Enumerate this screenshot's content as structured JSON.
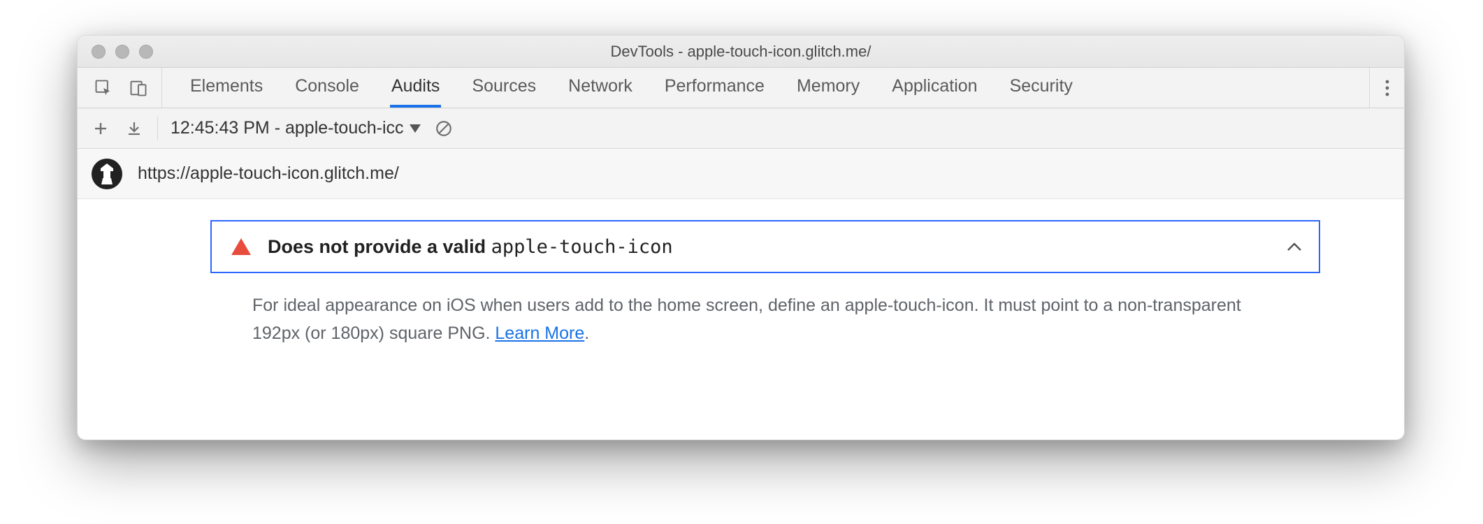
{
  "window": {
    "title": "DevTools - apple-touch-icon.glitch.me/"
  },
  "tabs": {
    "items": [
      "Elements",
      "Console",
      "Audits",
      "Sources",
      "Network",
      "Performance",
      "Memory",
      "Application",
      "Security"
    ],
    "active_index": 2
  },
  "toolbar": {
    "report_label": "12:45:43 PM - apple-touch-icc"
  },
  "report": {
    "url": "https://apple-touch-icon.glitch.me/"
  },
  "audit": {
    "title_prefix": "Does not provide a valid ",
    "title_code": "apple-touch-icon",
    "description_before_link": "For ideal appearance on iOS when users add to the home screen, define an apple-touch-icon. It must point to a non-transparent 192px (or 180px) square PNG. ",
    "learn_more": "Learn More",
    "description_after_link": "."
  }
}
